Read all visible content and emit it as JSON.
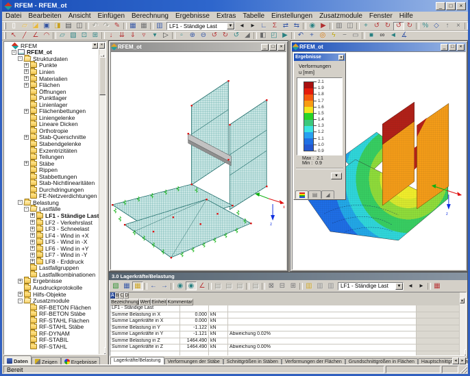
{
  "app": {
    "title": "RFEM - RFEM_ot",
    "status": "Bereit"
  },
  "window_buttons": [
    {
      "n": "minimize-button",
      "g": "_"
    },
    {
      "n": "maximize-button",
      "g": "□"
    },
    {
      "n": "close-button",
      "g": "×"
    }
  ],
  "menu": {
    "items": [
      {
        "t": "Datei"
      },
      {
        "t": "Bearbeiten"
      },
      {
        "t": "Ansicht"
      },
      {
        "t": "Einfügen"
      },
      {
        "t": "Berechnung"
      },
      {
        "t": "Ergebnisse"
      },
      {
        "t": "Extras"
      },
      {
        "t": "Tabelle"
      },
      {
        "t": "Einstellungen"
      },
      {
        "t": "Zusatzmodule"
      },
      {
        "t": "Fenster"
      },
      {
        "t": "Hilfe"
      }
    ]
  },
  "toolbar1": {
    "loadcase": "LF1 - Ständige Last",
    "dropdown_arrow": "▼",
    "items_a": [
      {
        "n": "new-file-icon",
        "g": "▯",
        "c": "#fdfdfd"
      },
      {
        "n": "open-file-icon",
        "g": "▱",
        "c": "#e8b93e"
      },
      {
        "n": "import-file-icon",
        "g": "◪",
        "c": "#e8b93e"
      },
      {
        "n": "save-icon",
        "g": "▣",
        "c": "#31519e"
      },
      {
        "n": "save-all-icon",
        "g": "◨",
        "c": "#c8a020"
      },
      {
        "n": "print-icon",
        "g": "▤",
        "c": "#4a4a4a"
      },
      {
        "n": "print-preview-icon",
        "g": "◫",
        "c": "#4a4a4a"
      },
      {
        "sep": 1,
        "n": "separator"
      },
      {
        "n": "undo-icon",
        "g": "↶",
        "d": 1
      },
      {
        "n": "redo-icon",
        "g": "↷",
        "d": 1
      },
      {
        "n": "edit-pencil-icon",
        "g": "✎",
        "c": "#b03030"
      },
      {
        "sep": 1,
        "n": "separator"
      },
      {
        "n": "show-tables-icon",
        "g": "▦",
        "c": "#31519e"
      },
      {
        "n": "show-grid-icon",
        "g": "▦",
        "c": "#6a6a6a"
      },
      {
        "sep": 1,
        "n": "separator"
      },
      {
        "n": "loadcase-book-icon",
        "g": "▥",
        "c": "#31519e"
      }
    ],
    "items_b": [
      {
        "n": "prev-loadcase-icon",
        "g": "◂",
        "c": "#222222"
      },
      {
        "n": "next-loadcase-icon",
        "g": "▸",
        "c": "#222222"
      },
      {
        "n": "loadcase-stairs-icon",
        "g": "∟",
        "c": "#31519e"
      },
      {
        "n": "sum-loads-icon",
        "g": "Σ",
        "c": "#b03030"
      },
      {
        "n": "move-load-icon",
        "g": "⇄",
        "c": "#31519e"
      },
      {
        "n": "swap-load-icon",
        "g": "⇆",
        "c": "#31519e"
      },
      {
        "sep": 1,
        "n": "separator"
      },
      {
        "n": "animation-icon",
        "g": "◉",
        "c": "#2a8080"
      },
      {
        "n": "render-flag-icon",
        "g": "▶",
        "c": "#b03030"
      },
      {
        "sep": 1,
        "n": "separator"
      },
      {
        "n": "copy-table-icon",
        "g": "▥",
        "c": "#6a6a6a"
      },
      {
        "n": "split-view-icon",
        "g": "◫",
        "c": "#6a6a6a"
      },
      {
        "sep": 1,
        "n": "separator"
      },
      {
        "n": "fe-mesh-icon",
        "g": "+",
        "c": "#2a8080"
      },
      {
        "n": "regenerate-1-icon",
        "g": "↺",
        "c": "#b03030"
      },
      {
        "n": "regenerate-2-icon",
        "g": "↻",
        "c": "#b03030"
      },
      {
        "n": "regenerate-3-icon",
        "g": "↺",
        "c": "#b03030",
        "p": 1
      },
      {
        "n": "regenerate-4-icon",
        "g": "↻",
        "c": "#b03030"
      },
      {
        "sep": 1,
        "n": "separator"
      },
      {
        "n": "link-percent-icon",
        "g": "%",
        "c": "#2a8080"
      },
      {
        "n": "code-icon",
        "g": "◇",
        "c": "#31519e"
      },
      {
        "n": "upload-icon",
        "g": "↑",
        "c": "#6a6a6a"
      },
      {
        "n": "delete-icon",
        "g": "×",
        "c": "#6a6a6a"
      },
      {
        "sep": 1,
        "n": "separator"
      },
      {
        "n": "add-surface-icon",
        "g": "+",
        "c": "#2a8080"
      },
      {
        "n": "surface-a-icon",
        "g": "◪",
        "c": "#2a8080"
      },
      {
        "n": "surface-b-icon",
        "g": "◩",
        "c": "#2a8080"
      },
      {
        "n": "angle-a-icon",
        "g": "◣",
        "c": "#b03030"
      },
      {
        "n": "angle-b-icon",
        "g": "◢",
        "c": "#333333"
      },
      {
        "n": "angle-c-icon",
        "g": "◥",
        "c": "#b03030"
      }
    ]
  },
  "toolbar2": {
    "items": [
      {
        "n": "select-pointer-icon",
        "g": "↖",
        "c": "#b03030"
      },
      {
        "n": "draw-line-icon",
        "g": "╱",
        "c": "#b03030"
      },
      {
        "n": "draw-polyline-icon",
        "g": "∠",
        "c": "#b03030"
      },
      {
        "n": "draw-arc-icon",
        "g": "◠",
        "c": "#b03030"
      },
      {
        "sep": 1,
        "n": "separator"
      },
      {
        "n": "new-surface-icon",
        "g": "▱",
        "c": "#2a8080"
      },
      {
        "n": "new-solid-icon",
        "g": "▧",
        "c": "#2a8080"
      },
      {
        "n": "new-node-icon",
        "g": "⊡",
        "c": "#2a8080"
      },
      {
        "n": "new-opening-icon",
        "g": "⊞",
        "c": "#2a8080"
      },
      {
        "sep": 1,
        "n": "separator"
      },
      {
        "n": "load-node-icon",
        "g": "↓",
        "c": "#b03030"
      },
      {
        "n": "load-line-icon",
        "g": "⇊",
        "c": "#b03030"
      },
      {
        "n": "load-surface-icon",
        "g": "⇓",
        "c": "#b03030"
      },
      {
        "n": "load-free-icon",
        "g": "▿",
        "c": "#b03030"
      },
      {
        "n": "load-generated-icon",
        "g": "▾",
        "c": "#2a8080"
      },
      {
        "n": "generate-icon",
        "g": "▷",
        "c": "#333333"
      },
      {
        "sep": 1,
        "n": "separator"
      },
      {
        "n": "zoom-window-icon",
        "g": "▫",
        "c": "#2a8080"
      },
      {
        "n": "zoom-in-icon",
        "g": "⊕",
        "c": "#31519e"
      },
      {
        "n": "zoom-out-icon",
        "g": "⊖",
        "c": "#31519e"
      },
      {
        "n": "rotate-x-icon",
        "g": "↺",
        "c": "#b03030"
      },
      {
        "n": "rotate-y-icon",
        "g": "↻",
        "c": "#b03030"
      },
      {
        "n": "rotate-z-icon",
        "g": "↺",
        "c": "#2a8080"
      },
      {
        "n": "perspective-icon",
        "g": "◢",
        "c": "#6a6a6a"
      },
      {
        "sep": 1,
        "n": "separator"
      },
      {
        "n": "clip-plane-icon",
        "g": "◧",
        "c": "#6a6a6a"
      },
      {
        "n": "isometric-view-icon",
        "g": "◰",
        "c": "#2a8080"
      },
      {
        "n": "view-direction-icon",
        "g": "▶",
        "c": "#2a8080"
      },
      {
        "sep": 1,
        "n": "separator"
      },
      {
        "n": "previous-view-icon",
        "g": "↶",
        "c": "#31519e"
      },
      {
        "n": "move-view-icon",
        "g": "+",
        "c": "#31519e"
      },
      {
        "n": "center-view-icon",
        "g": "◎",
        "c": "#d07000"
      },
      {
        "n": "quick-view-icon",
        "g": "ϟ",
        "c": "#b8a000"
      },
      {
        "n": "zoom-minus-icon",
        "g": "−",
        "c": "#6a6a6a"
      },
      {
        "n": "full-window-icon",
        "g": "▭",
        "c": "#6a6a6a"
      },
      {
        "sep": 1,
        "n": "separator"
      },
      {
        "n": "render-solid-icon",
        "g": "■",
        "c": "#2a8080"
      },
      {
        "n": "show-results-icon",
        "g": "∞",
        "c": "#222222"
      },
      {
        "n": "pan-hand-icon",
        "g": "◄",
        "c": "#2a8080"
      },
      {
        "n": "measure-angle-icon",
        "g": "∡",
        "c": "#31519e"
      }
    ]
  },
  "tree": {
    "items": [
      {
        "t": "RFEM",
        "v": 0,
        "i": "app"
      },
      {
        "t": "RFEM_ot",
        "v": 1,
        "e": "-",
        "i": "doc",
        "b": 1
      },
      {
        "t": "Strukturdaten",
        "v": 2,
        "e": "-",
        "i": "fo"
      },
      {
        "t": "Punkte",
        "v": 3,
        "e": "+",
        "i": "f"
      },
      {
        "t": "Linien",
        "v": 3,
        "e": "+",
        "i": "f"
      },
      {
        "t": "Materialien",
        "v": 3,
        "e": "+",
        "i": "f"
      },
      {
        "t": "Flächen",
        "v": 3,
        "e": "+",
        "i": "f"
      },
      {
        "t": "Öffnungen",
        "v": 3,
        "i": "f"
      },
      {
        "t": "Punktlager",
        "v": 3,
        "i": "f"
      },
      {
        "t": "Linienlager",
        "v": 3,
        "i": "f"
      },
      {
        "t": "Flächenbettungen",
        "v": 3,
        "e": "+",
        "i": "f"
      },
      {
        "t": "Liniengelenke",
        "v": 3,
        "i": "f"
      },
      {
        "t": "Lineare Dicken",
        "v": 3,
        "i": "f"
      },
      {
        "t": "Orthotropie",
        "v": 3,
        "i": "f"
      },
      {
        "t": "Stab-Querschnitte",
        "v": 3,
        "e": "+",
        "i": "f"
      },
      {
        "t": "Stabendgelenke",
        "v": 3,
        "i": "f"
      },
      {
        "t": "Exzentrizitäten",
        "v": 3,
        "i": "f"
      },
      {
        "t": "Teilungen",
        "v": 3,
        "i": "f"
      },
      {
        "t": "Stäbe",
        "v": 3,
        "e": "+",
        "i": "f"
      },
      {
        "t": "Rippen",
        "v": 3,
        "i": "f"
      },
      {
        "t": "Stabbettungen",
        "v": 3,
        "i": "f"
      },
      {
        "t": "Stab-Nichtlinearitäten",
        "v": 3,
        "i": "f"
      },
      {
        "t": "Durchdringungen",
        "v": 3,
        "i": "f"
      },
      {
        "t": "FE-Netzverdichtungen",
        "v": 3,
        "i": "f"
      },
      {
        "t": "Belastung",
        "v": 2,
        "e": "-",
        "i": "fo"
      },
      {
        "t": "Lastfälle",
        "v": 3,
        "e": "-",
        "i": "fo"
      },
      {
        "t": "LF1 - Ständige Last",
        "v": 4,
        "e": "+",
        "i": "f",
        "b": 1
      },
      {
        "t": "LF2 - Verkehrslast",
        "v": 4,
        "e": "+",
        "i": "f"
      },
      {
        "t": "LF3 - Schneelast",
        "v": 4,
        "e": "+",
        "i": "f"
      },
      {
        "t": "LF4 - Wind in +X",
        "v": 4,
        "e": "+",
        "i": "f"
      },
      {
        "t": "LF5 - Wind in -X",
        "v": 4,
        "e": "+",
        "i": "f"
      },
      {
        "t": "LF6 - Wind in +Y",
        "v": 4,
        "e": "+",
        "i": "f"
      },
      {
        "t": "LF7 - Wind in -Y",
        "v": 4,
        "e": "+",
        "i": "f"
      },
      {
        "t": "LF8 - Erddruck",
        "v": 4,
        "e": "+",
        "i": "f"
      },
      {
        "t": "Lastfallgruppen",
        "v": 3,
        "i": "f"
      },
      {
        "t": "Lastfallkombinationen",
        "v": 3,
        "i": "f"
      },
      {
        "t": "Ergebnisse",
        "v": 2,
        "e": "+",
        "i": "f"
      },
      {
        "t": "Ausdruckprotokolle",
        "v": 2,
        "i": "f"
      },
      {
        "t": "Hilfs-Objekte",
        "v": 2,
        "e": "+",
        "i": "f"
      },
      {
        "t": "Zusatzmodule",
        "v": 2,
        "e": "-",
        "i": "fo"
      },
      {
        "t": "RF-BETON Flächen",
        "v": 3,
        "i": "f"
      },
      {
        "t": "RF-BETON Stäbe",
        "v": 3,
        "i": "f"
      },
      {
        "t": "RF-STAHL Flächen",
        "v": 3,
        "i": "f"
      },
      {
        "t": "RF-STAHL Stäbe",
        "v": 3,
        "i": "f"
      },
      {
        "t": "RF-DYNAM",
        "v": 3,
        "i": "f"
      },
      {
        "t": "RF-STABIL",
        "v": 3,
        "i": "f"
      },
      {
        "t": "RF-STAHL",
        "v": 3,
        "i": "f"
      }
    ]
  },
  "sidebar": {
    "buttons": [
      {
        "n": "panel-dock-icon",
        "g": "▾"
      },
      {
        "n": "panel-close-icon",
        "g": "×"
      }
    ],
    "scroll_up": "▲",
    "scroll_down": "▼"
  },
  "side_tabs": {
    "items": [
      {
        "t": "Daten",
        "on": 1,
        "ic": "daten"
      },
      {
        "t": "Zeigen",
        "ic": "zeigen"
      },
      {
        "t": "Ergebnisse",
        "ic": "ergebnisse"
      }
    ]
  },
  "win1": {
    "title": "RFEM_ot",
    "axis_x": "x",
    "axis_z": "z"
  },
  "win2": {
    "title": "RFEM_ot",
    "axis_z": "z"
  },
  "legend": {
    "title": "Ergebnisse",
    "collapse_glyph": "▾",
    "quantity": "Verformungen",
    "unit": "u [mm]",
    "ticks": [
      "2.1",
      "1.9",
      "1.8",
      "1.7",
      "1.6",
      "1.5",
      "1.4",
      "1.3",
      "1.2",
      "1.1",
      "1.0",
      "0.9"
    ],
    "bands": [
      "#a81010",
      "#e41c0c",
      "#f45a10",
      "#f89c14",
      "#f4e420",
      "#28d428",
      "#3cc87c",
      "#3ce4e0",
      "#28a0f0",
      "#2070e4",
      "#2458d0"
    ],
    "max_label": "Max :",
    "max_value": "2.1",
    "min_label": "Min :",
    "min_value": "0.9",
    "dropdown_arrow": "▼",
    "tabs": [
      {
        "n": "legend-tab-colorscale",
        "on": 1,
        "kind": "scale"
      },
      {
        "n": "legend-tab-pages",
        "g": "▤"
      },
      {
        "n": "legend-tab-ramp",
        "g": "◢"
      }
    ]
  },
  "table": {
    "title": "3.0 Lagerkräfte/Belastung",
    "loadcase": "LF1 - Ständige Last",
    "dropdown_arrow": "▼",
    "tools_a": [
      {
        "n": "export-chart-icon",
        "g": "▧",
        "c": "#2a8a2a"
      },
      {
        "n": "table-settings-icon",
        "g": "▦",
        "c": "#31519e"
      },
      {
        "n": "table-highlight-icon",
        "g": "▦",
        "c": "#c8a020",
        "p": 1
      },
      {
        "sep": 1,
        "n": "separator"
      },
      {
        "n": "jump-prev-icon",
        "g": "←",
        "c": "#31519e"
      },
      {
        "n": "jump-next-icon",
        "g": "→",
        "c": "#31519e"
      },
      {
        "sep": 1,
        "n": "separator"
      },
      {
        "n": "filter-a-icon",
        "g": "◉",
        "c": "#2a8080"
      },
      {
        "n": "filter-b-icon",
        "g": "◉",
        "c": "#2a8080",
        "p": 1
      },
      {
        "n": "edit-angle-icon",
        "g": "∠",
        "c": "#b03030"
      },
      {
        "sep": 1,
        "n": "separator"
      },
      {
        "n": "calc-view-1-icon",
        "g": "▤",
        "d": 1
      },
      {
        "n": "calc-view-2-icon",
        "g": "▤",
        "d": 1
      },
      {
        "n": "calc-view-3-icon",
        "g": "▤",
        "d": 1
      },
      {
        "sep": 1,
        "n": "separator"
      },
      {
        "n": "calc-view-4-icon",
        "g": "▤",
        "d": 1
      },
      {
        "sep": 1,
        "n": "separator"
      },
      {
        "n": "delete-row-icon",
        "g": "⊠",
        "c": "#6a6a6a"
      },
      {
        "n": "insert-row-icon",
        "g": "⊟",
        "c": "#6a6a6a"
      },
      {
        "n": "add-row-icon",
        "g": "⊞",
        "c": "#6a6a6a"
      },
      {
        "sep": 1,
        "n": "separator"
      },
      {
        "n": "sheet-copy-icon",
        "g": "▥",
        "c": "#c8a020"
      },
      {
        "n": "sheet-new-icon",
        "g": "▥",
        "c": "#888888"
      },
      {
        "n": "sheet-clear-icon",
        "g": "▥",
        "c": "#888888"
      }
    ],
    "tools_b": [
      {
        "n": "prev-table-icon",
        "g": "◂",
        "c": "#222222"
      },
      {
        "n": "next-table-icon",
        "g": "▸",
        "c": "#222222"
      },
      {
        "sep": 1,
        "n": "separator"
      },
      {
        "n": "table-picture-icon",
        "g": "▦",
        "c": "#b03030"
      }
    ],
    "letters": [
      {
        "t": "A",
        "on": 1
      },
      {
        "t": "B"
      },
      {
        "t": "C"
      },
      {
        "t": "D"
      }
    ],
    "headers": [
      {
        "t": "Bezeichnung"
      },
      {
        "t": "Wert"
      },
      {
        "t": "Einheit"
      },
      {
        "t": "Kommentar"
      }
    ],
    "rows": [
      {
        "a": "LF1 - Ständige Last",
        "b": "",
        "c": "",
        "d": "",
        "g": 1
      },
      {
        "a": "Summe Belastung in X",
        "b": "0.000",
        "c": "kN",
        "d": ""
      },
      {
        "a": "Summe Lagerkräfte in X",
        "b": "0.000",
        "c": "kN",
        "d": ""
      },
      {
        "a": "Summe Belastung in Y",
        "b": "-1.122",
        "c": "kN",
        "d": ""
      },
      {
        "a": "Summe Lagerkräfte in Y",
        "b": "-1.121",
        "c": "kN",
        "d": "Abweichung 0.02%"
      },
      {
        "a": "Summe Belastung in Z",
        "b": "1464.490",
        "c": "kN",
        "d": ""
      },
      {
        "a": "Summe Lagerkräfte in Z",
        "b": "1464.490",
        "c": "kN",
        "d": "Abweichung 0.00%"
      },
      {
        "a": "",
        "b": "",
        "c": "",
        "d": ""
      }
    ],
    "tabs": [
      {
        "t": "Lagerkräfte/Belastung",
        "on": 1
      },
      {
        "t": "Verformungen der Stäbe"
      },
      {
        "t": "Schnittgrößen in Stäben"
      },
      {
        "t": "Verformungen der Flächen"
      },
      {
        "t": "Grundschnittgrößen in Flächen"
      },
      {
        "t": "Hauptschnittgrößen in Flächen"
      }
    ],
    "tab_scroll_left": "◂",
    "tab_scroll_right": "▸"
  }
}
